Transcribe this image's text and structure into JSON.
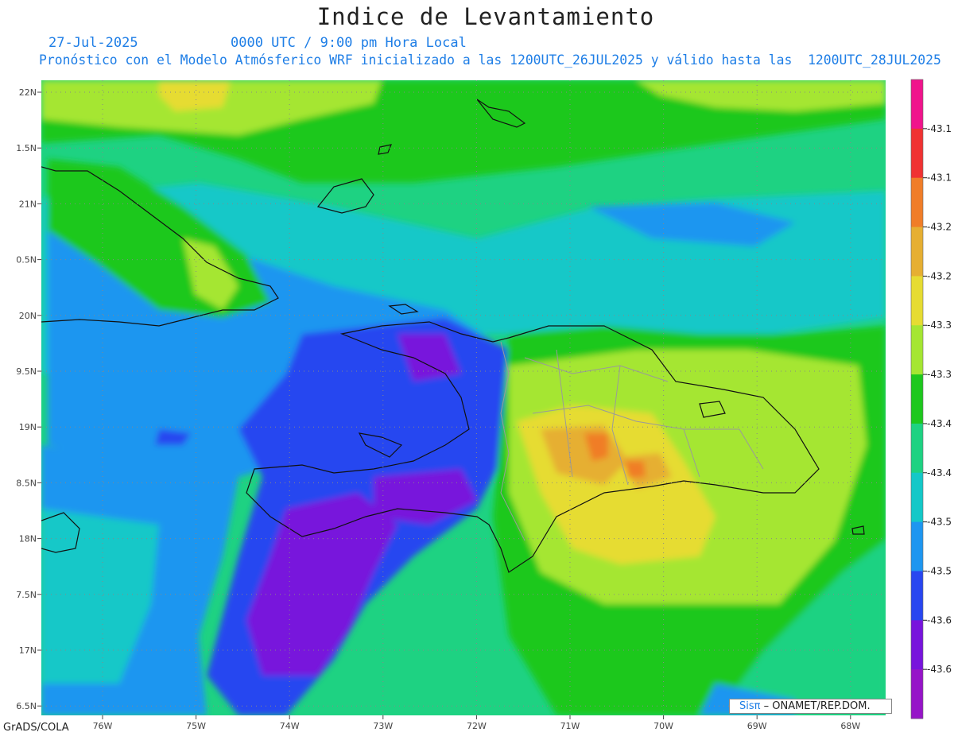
{
  "header": {
    "title": "Indice de Levantamiento",
    "date": "27-Jul-2025",
    "time": "0000 UTC / 9:00 pm Hora Local",
    "description": "Pronóstico con el Modelo Atmósferico WRF inicializado a las 1200UTC_26JUL2025 y válido hasta las  1200UTC_28JUL2025"
  },
  "map": {
    "lat_labels": [
      "22N",
      "1.5N",
      "21N",
      "0.5N",
      "20N",
      "9.5N",
      "19N",
      "8.5N",
      "18N",
      "7.5N",
      "17N",
      "6.5N"
    ],
    "lon_labels": [
      "76W",
      "75W",
      "74W",
      "73W",
      "72W",
      "71W",
      "70W",
      "69W",
      "68W"
    ],
    "grid": true
  },
  "colorbar": {
    "labels": [
      "-43.1",
      "-43.1",
      "-43.2",
      "-43.2",
      "-43.3",
      "-43.3",
      "-43.4",
      "-43.4",
      "-43.5",
      "-43.5",
      "-43.6",
      "-43.6"
    ],
    "colors": [
      "#f0148c",
      "#f03232",
      "#f07d28",
      "#e6af32",
      "#e6dc32",
      "#a5e632",
      "#1ec81e",
      "#1ed282",
      "#14c8c8",
      "#1e96f0",
      "#2846f0",
      "#7814dc",
      "#9614c8"
    ]
  },
  "palette": {
    "ocean_base": "#1ed282",
    "cyan": "#14c8c8",
    "lightblue": "#1e96f0",
    "blue": "#2846f0",
    "purple": "#7814dc",
    "green": "#1ec81e",
    "lime": "#a5e632",
    "yellow": "#e6dc32",
    "orange": "#e6af32",
    "red_orange": "#f07d28"
  },
  "footer": {
    "credit_logo": "Sisπ",
    "credit_text": "– ONAMET/REP.DOM.",
    "software": "GrADS/COLA"
  }
}
